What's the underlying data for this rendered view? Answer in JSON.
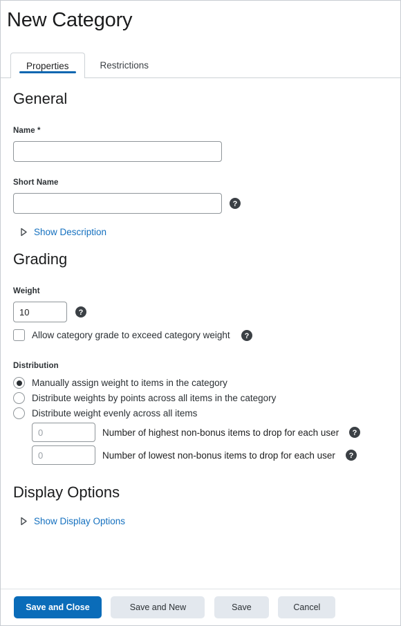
{
  "page": {
    "title": "New Category"
  },
  "tabs": [
    {
      "label": "Properties",
      "active": true
    },
    {
      "label": "Restrictions",
      "active": false
    }
  ],
  "general": {
    "heading": "General",
    "name": {
      "label": "Name",
      "required_mark": "*",
      "value": "",
      "placeholder": ""
    },
    "short_name": {
      "label": "Short Name",
      "value": "",
      "placeholder": "",
      "help_icon": "help-circle-icon"
    },
    "description_expander": {
      "label": "Show Description",
      "icon": "triangle-right-icon"
    }
  },
  "grading": {
    "heading": "Grading",
    "weight": {
      "label": "Weight",
      "value": "10",
      "placeholder": "",
      "help_icon": "help-circle-icon"
    },
    "exceed_weight": {
      "label": "Allow category grade to exceed category weight",
      "checked": false,
      "help_icon": "help-circle-icon"
    },
    "distribution": {
      "label": "Distribution",
      "options": [
        {
          "label": "Manually assign weight to items in the category",
          "selected": true
        },
        {
          "label": "Distribute weights by points across all items in the category",
          "selected": false
        },
        {
          "label": "Distribute weight evenly across all items",
          "selected": false
        }
      ],
      "drop_rules": [
        {
          "value": "",
          "placeholder": "0",
          "label": "Number of highest non-bonus items to drop for each user",
          "help_icon": "help-circle-icon"
        },
        {
          "value": "",
          "placeholder": "0",
          "label": "Number of lowest non-bonus items to drop for each user",
          "help_icon": "help-circle-icon"
        }
      ]
    }
  },
  "display_options": {
    "heading": "Display Options",
    "expander": {
      "label": "Show Display Options",
      "icon": "triangle-right-icon"
    }
  },
  "buttons": {
    "save_and_close": "Save and Close",
    "save_and_new": "Save and New",
    "save": "Save",
    "cancel": "Cancel"
  },
  "colors": {
    "primary_blue": "#0a6cb9",
    "link_blue": "#1470bf",
    "tab_underline": "#0a66b0",
    "secondary_button": "#e3e8ee",
    "border_gray": "#8f9599"
  }
}
